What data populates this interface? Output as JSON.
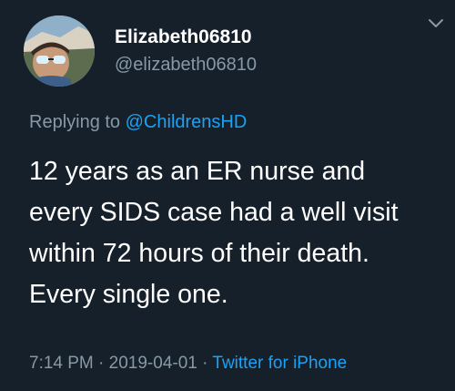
{
  "user": {
    "display_name": "Elizabeth06810",
    "handle": "@elizabeth06810"
  },
  "reply": {
    "prefix": "Replying to ",
    "mention": "@ChildrensHD"
  },
  "tweet": {
    "text": "12 years as an ER nurse and\nevery SIDS case  had a well visit\nwithin 72 hours of their death.\nEvery single one."
  },
  "meta": {
    "time": "7:14 PM",
    "separator1": " · ",
    "date": "2019-04-01",
    "separator2": " · ",
    "source": "Twitter for iPhone"
  },
  "icons": {
    "menu": "chevron-down-icon"
  },
  "colors": {
    "background": "#15202b",
    "secondary_text": "#8899a6",
    "link": "#1da1f2",
    "primary_text": "#ffffff"
  }
}
